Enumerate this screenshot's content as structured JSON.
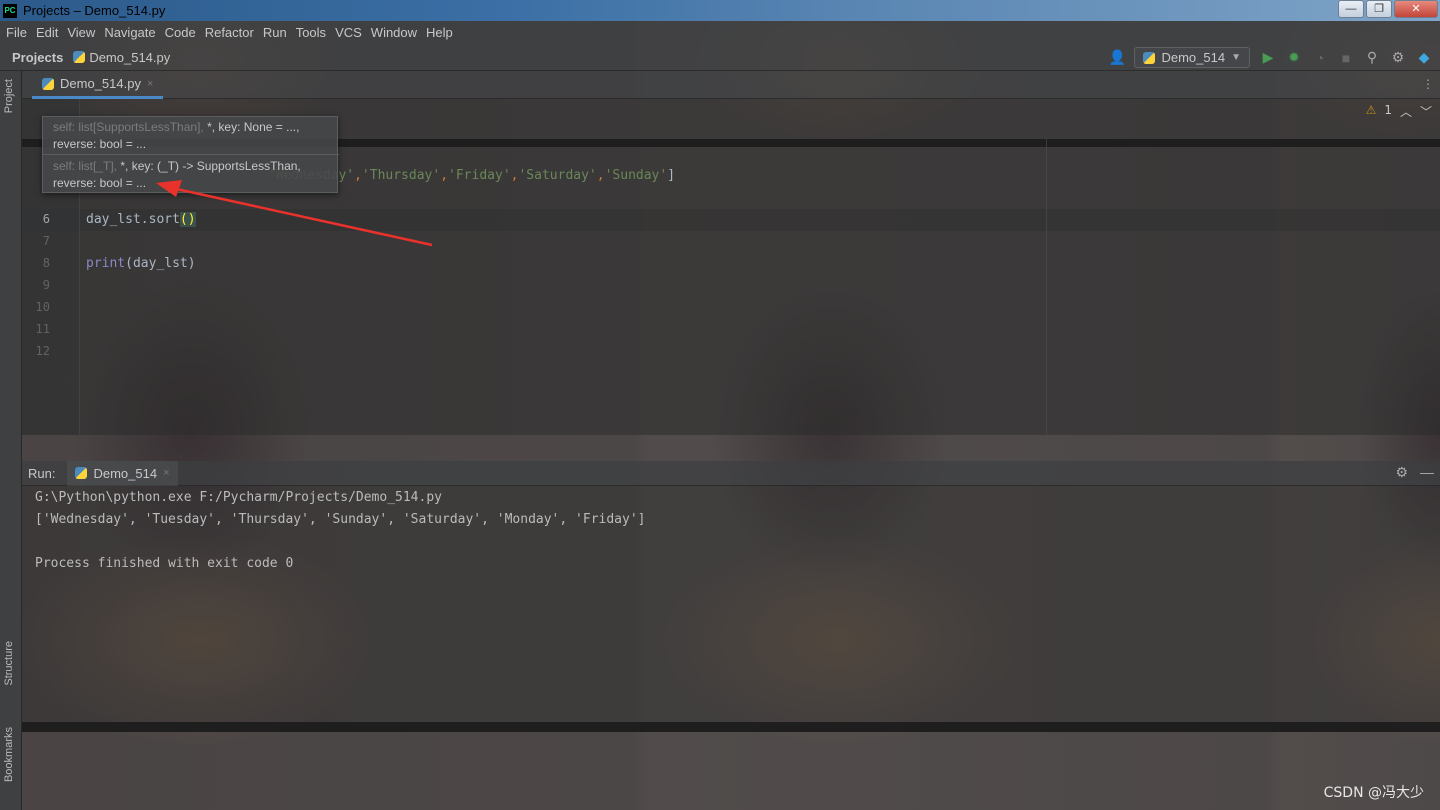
{
  "window": {
    "app_icon_text": "PC",
    "title": "Projects – Demo_514.py",
    "buttons": [
      "—",
      "❐",
      "✕"
    ]
  },
  "menu": [
    "File",
    "Edit",
    "View",
    "Navigate",
    "Code",
    "Refactor",
    "Run",
    "Tools",
    "VCS",
    "Window",
    "Help"
  ],
  "navbar": {
    "project": "Projects",
    "file": "Demo_514.py",
    "run_config": "Demo_514"
  },
  "tool_windows": {
    "project": "Project",
    "structure": "Structure",
    "bookmarks": "Bookmarks"
  },
  "editor": {
    "tab_label": "Demo_514.py",
    "inspection_count": "1",
    "lines": [
      {
        "no": "6",
        "current": true
      },
      {
        "no": "7"
      },
      {
        "no": "8"
      },
      {
        "no": "9"
      },
      {
        "no": "10"
      },
      {
        "no": "11"
      },
      {
        "no": "12"
      }
    ],
    "list_line": {
      "s1": "'Wednesday'",
      "s2": "'Thursday'",
      "s3": "'Friday'",
      "s4": "'Saturday'",
      "s5": "'Sunday'",
      "comma": ",",
      "close": "]"
    },
    "sort_line": {
      "code": "day_lst.sort",
      "parens": "()"
    },
    "print_line": {
      "builtin": "print",
      "args": "(day_lst)"
    }
  },
  "param_popup": {
    "sig1_dim": "self: list[SupportsLessThan],",
    "sig1_rest": " *, key: None = ...,",
    "sig1_line2": "reverse: bool = ...",
    "sig2_dim": "self: list[_T],",
    "sig2_rest": " *, key: (_T) -> SupportsLessThan,",
    "sig2_line2": "reverse: bool = ..."
  },
  "run_panel": {
    "label": "Run:",
    "tab": "Demo_514",
    "output": [
      "G:\\Python\\python.exe F:/Pycharm/Projects/Demo_514.py",
      "['Wednesday', 'Tuesday', 'Thursday', 'Sunday', 'Saturday', 'Monday', 'Friday']",
      "",
      "Process finished with exit code 0"
    ]
  },
  "watermark": "CSDN @冯大少",
  "colors": {
    "string": "#6a8759",
    "keyword_orange": "#cc7832",
    "builtin": "#8888c6",
    "arrow": "#e8322b",
    "tab_underline": "#4a88c7"
  },
  "icons": [
    "pycharm-logo-icon",
    "python-file-icon",
    "user-icon",
    "run-icon",
    "debug-icon",
    "search-icon",
    "gear-icon",
    "warning-icon",
    "arrow-up-icon",
    "arrow-down-icon",
    "minimize-icon",
    "more-icon"
  ]
}
